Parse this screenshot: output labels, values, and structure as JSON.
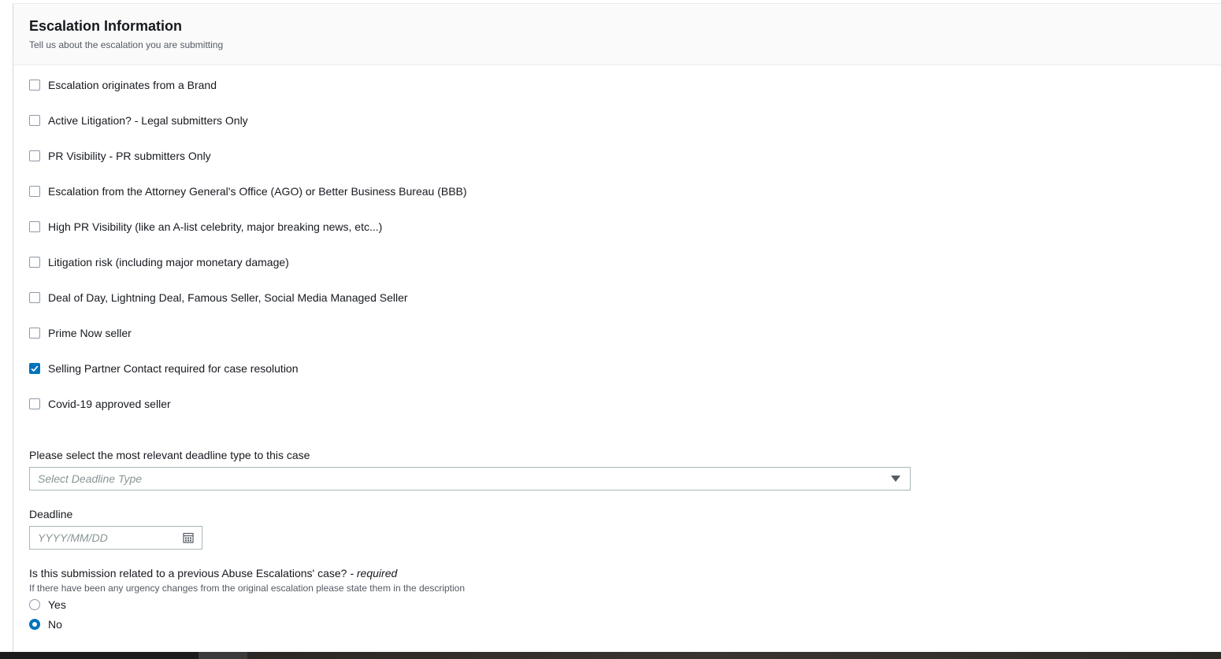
{
  "header": {
    "title": "Escalation Information",
    "subtitle": "Tell us about the escalation you are submitting"
  },
  "checkboxes": [
    {
      "label": "Escalation originates from a Brand",
      "checked": false
    },
    {
      "label": "Active Litigation? - Legal submitters Only",
      "checked": false
    },
    {
      "label": "PR Visibility - PR submitters Only",
      "checked": false
    },
    {
      "label": "Escalation from the Attorney General's Office (AGO) or Better Business Bureau (BBB)",
      "checked": false
    },
    {
      "label": "High PR Visibility (like an A-list celebrity, major breaking news, etc...)",
      "checked": false
    },
    {
      "label": "Litigation risk (including major monetary damage)",
      "checked": false
    },
    {
      "label": "Deal of Day, Lightning Deal, Famous Seller, Social Media Managed Seller",
      "checked": false
    },
    {
      "label": "Prime Now seller",
      "checked": false
    },
    {
      "label": "Selling Partner Contact required for case resolution",
      "checked": true
    },
    {
      "label": "Covid-19 approved seller",
      "checked": false
    }
  ],
  "deadline_type": {
    "label": "Please select the most relevant deadline type to this case",
    "placeholder": "Select Deadline Type"
  },
  "deadline": {
    "label": "Deadline",
    "placeholder": "YYYY/MM/DD"
  },
  "previous_case": {
    "question": "Is this submission related to a previous Abuse Escalations' case?",
    "required_text": " - required",
    "description": "If there have been any urgency changes from the original escalation please state them in the description",
    "options": [
      {
        "label": "Yes",
        "selected": false
      },
      {
        "label": "No",
        "selected": true
      }
    ]
  },
  "colors": {
    "accent": "#0073bb",
    "header_bg": "#fafafa",
    "border": "#aab7b8"
  },
  "icons": {
    "checkmark": "check-icon",
    "calendar": "calendar-icon",
    "dropdown": "caret-down-icon"
  }
}
